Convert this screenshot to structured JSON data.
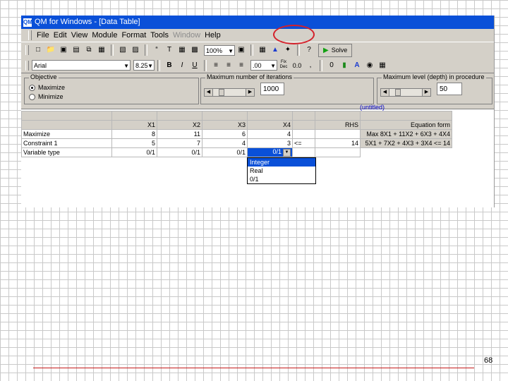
{
  "window": {
    "title": "QM for Windows - [Data Table]"
  },
  "menu": [
    "File",
    "Edit",
    "View",
    "Module",
    "Format",
    "Tools",
    "Window",
    "Help"
  ],
  "toolbar": {
    "zoom": "100%",
    "decimals": ".00",
    "fix_dec_top": "Fix",
    "fix_dec_bottom": "Dec",
    "fix_value": "0.0",
    "solve_label": "Solve",
    "font_name": "Arial",
    "font_size": "8.25"
  },
  "options": {
    "objective_label": "Objective",
    "maximize_label": "Maximize",
    "minimize_label": "Minimize",
    "max_iterations_label": "Maximum number of iterations",
    "max_iterations_value": "1000",
    "max_level_label": "Maximum level (depth) in procedure",
    "max_level_value": "50"
  },
  "doc_title": "(untitled)",
  "table": {
    "headers": [
      "",
      "X1",
      "X2",
      "X3",
      "X4",
      "",
      "RHS",
      "Equation form"
    ],
    "rows": [
      {
        "label": "Maximize",
        "values": [
          "8",
          "11",
          "6",
          "4"
        ],
        "sign": "",
        "rhs": "",
        "eq": "Max  8X1 + 11X2 + 6X3 + 4X4"
      },
      {
        "label": "Constraint 1",
        "values": [
          "5",
          "7",
          "4",
          "3"
        ],
        "sign": "<=",
        "rhs": "14",
        "eq": "5X1 + 7X2 + 4X3 + 3X4 <= 14"
      },
      {
        "label": "Variable type",
        "values": [
          "0/1",
          "0/1",
          "0/1",
          "0/1"
        ],
        "sign": "",
        "rhs": "",
        "eq": ""
      }
    ]
  },
  "dropdown": {
    "options": [
      "Integer",
      "Real",
      "0/1"
    ],
    "highlighted": "Integer"
  },
  "page_number": "68",
  "colors": {
    "title_bar": "#0a50d8",
    "chrome": "#d4d0c8",
    "annotation": "#d4202a"
  }
}
